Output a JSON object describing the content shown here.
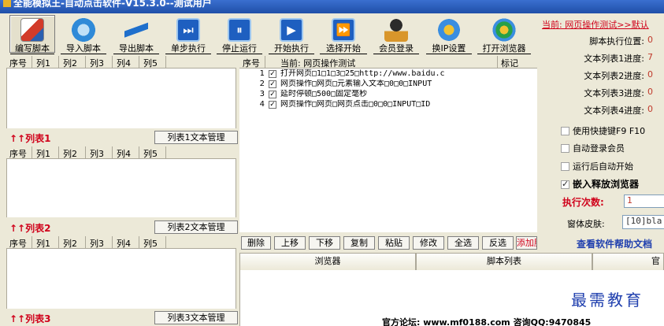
{
  "window": {
    "title": "全能模拟王-自动点击软件-V15.3.0--测试用户"
  },
  "toolbar": {
    "buttons": [
      {
        "label": "编写脚本"
      },
      {
        "label": "导入脚本"
      },
      {
        "label": "导出脚本"
      },
      {
        "label": "单步执行"
      },
      {
        "label": "停止运行"
      },
      {
        "label": "开始执行"
      },
      {
        "label": "选择开始"
      },
      {
        "label": "会员登录"
      },
      {
        "label": "换IP设置"
      },
      {
        "label": "打开浏览器"
      }
    ]
  },
  "lists": {
    "columns": [
      "序号",
      "列1",
      "列2",
      "列3",
      "列4",
      "列5"
    ],
    "items": [
      {
        "title": "↑↑列表1",
        "button": "列表1文本管理"
      },
      {
        "title": "↑↑列表2",
        "button": "列表2文本管理"
      },
      {
        "title": "↑↑列表3",
        "button": "列表3文本管理"
      }
    ]
  },
  "script": {
    "columns": [
      "序号",
      "当前: 网页操作测试",
      "标记"
    ],
    "rows": [
      {
        "index": "1",
        "checked": true,
        "command": "打开网页□1□1□3□25□http://www.baidu.c"
      },
      {
        "index": "2",
        "checked": true,
        "command": "网页操作□网页□元素输入文本□0□0□INPUT"
      },
      {
        "index": "3",
        "checked": true,
        "command": "延时停顿□500□固定毫秒"
      },
      {
        "index": "4",
        "checked": true,
        "command": "网页操作□网页□网页点击□0□0□INPUT□ID"
      }
    ]
  },
  "actions": {
    "buttons": [
      "删除",
      "上移",
      "下移",
      "复制",
      "粘贴",
      "修改",
      "全选",
      "反选",
      "添加脚本"
    ]
  },
  "right_panel": {
    "current": "当前: 网页操作测试>>默认",
    "stats": [
      {
        "key": "脚本执行位置:",
        "value": "0"
      },
      {
        "key": "文本列表1进度:",
        "value": "7"
      },
      {
        "key": "文本列表2进度:",
        "value": "0"
      },
      {
        "key": "文本列表3进度:",
        "value": "0"
      },
      {
        "key": "文本列表4进度:",
        "value": "0"
      }
    ],
    "options": [
      {
        "label": "使用快捷键F9 F10",
        "checked": false,
        "bold": false
      },
      {
        "label": "自动登录会员",
        "checked": false,
        "bold": false
      },
      {
        "label": "运行后自动开始",
        "checked": false,
        "bold": false
      },
      {
        "label": "嵌入释放浏览器",
        "checked": true,
        "bold": true
      }
    ],
    "exec_count_label": "执行次数:",
    "exec_count_value": "1",
    "skin_label": "窗体皮肤:",
    "skin_value": "[10]bla",
    "help_link": "查看软件帮助文档"
  },
  "tabs": {
    "items": [
      "浏览器",
      "脚本列表",
      "官"
    ]
  },
  "browser": {
    "watermark": "最需教育",
    "forum": "官方论坛: www.mf0188.com  咨询QQ:9470845"
  }
}
